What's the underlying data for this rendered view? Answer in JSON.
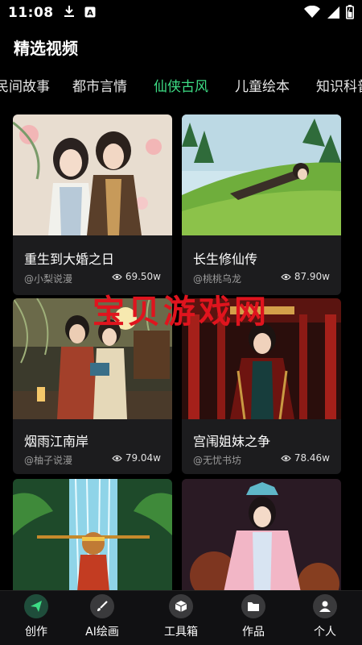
{
  "status": {
    "time": "11:08",
    "icons": [
      "download-icon",
      "keyboard-a-icon",
      "wifi-icon",
      "signal-icon",
      "battery-icon"
    ]
  },
  "page": {
    "title": "精选视频"
  },
  "tabs": [
    {
      "label": "民间故事"
    },
    {
      "label": "都市言情"
    },
    {
      "label": "仙侠古风",
      "active": true
    },
    {
      "label": "儿童绘本"
    },
    {
      "label": "知识科普"
    }
  ],
  "cards": [
    {
      "title": "重生到大婚之日",
      "author": "@小梨说漫",
      "views": "69.50w"
    },
    {
      "title": "长生修仙传",
      "author": "@桃桃乌龙",
      "views": "87.90w"
    },
    {
      "title": "烟雨江南岸",
      "author": "@柚子说漫",
      "views": "79.04w"
    },
    {
      "title": "宫闱姐妹之争",
      "author": "@无忧书坊",
      "views": "78.46w"
    },
    {
      "title": "",
      "author": "",
      "views": ""
    },
    {
      "title": "",
      "author": "",
      "views": ""
    }
  ],
  "watermark": "宝贝游戏网",
  "nav": [
    {
      "label": "创作",
      "icon": "send-icon",
      "active": true
    },
    {
      "label": "AI绘画",
      "icon": "brush-icon"
    },
    {
      "label": "工具箱",
      "icon": "box-icon"
    },
    {
      "label": "作品",
      "icon": "folder-icon"
    },
    {
      "label": "个人",
      "icon": "user-icon"
    }
  ],
  "colors": {
    "accent": "#3ddc84",
    "watermark": "#e0141e",
    "card_bg": "#1c1c1e"
  }
}
